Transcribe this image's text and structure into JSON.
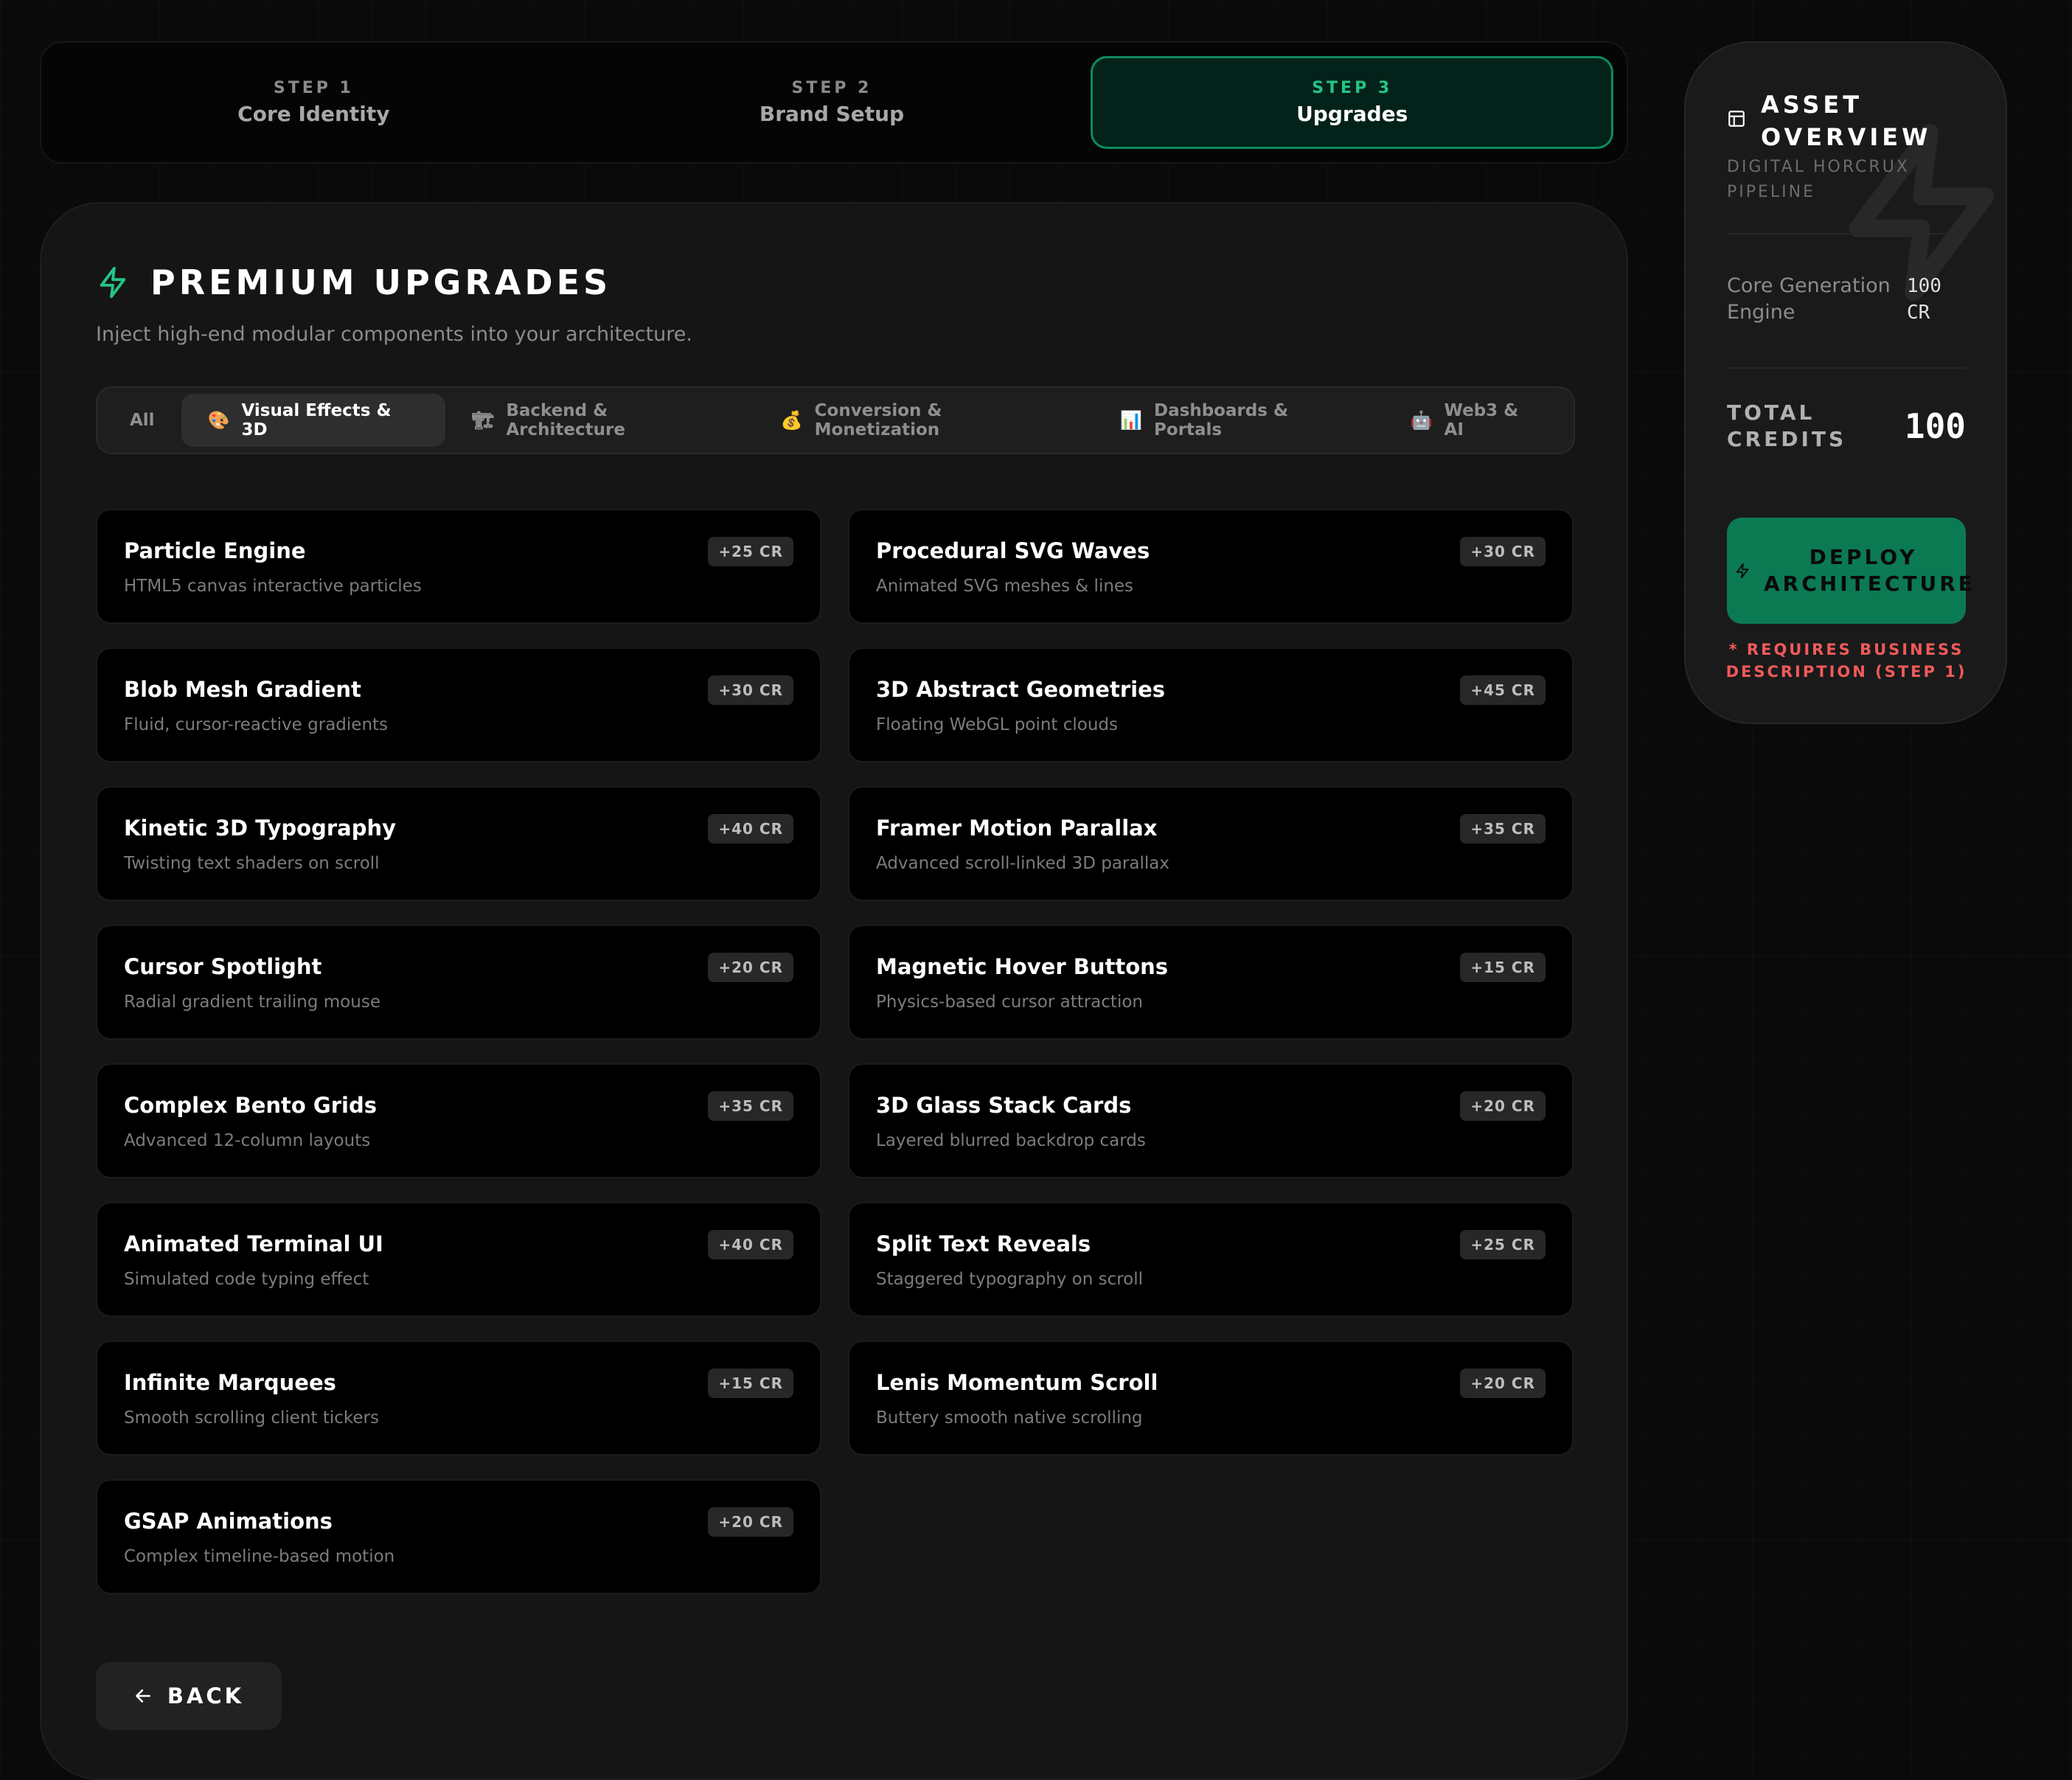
{
  "stepper": {
    "steps": [
      {
        "num": "STEP 1",
        "title": "Core Identity"
      },
      {
        "num": "STEP 2",
        "title": "Brand Setup"
      },
      {
        "num": "STEP 3",
        "title": "Upgrades"
      }
    ],
    "active_step": 3
  },
  "panel": {
    "title": "PREMIUM UPGRADES",
    "subtitle": "Inject high-end modular components into your architecture."
  },
  "tabs": [
    {
      "label": "All",
      "icon": ""
    },
    {
      "label": "Visual Effects & 3D",
      "icon": "🎨"
    },
    {
      "label": "Backend & Architecture",
      "icon": "🏗"
    },
    {
      "label": "Conversion & Monetization",
      "icon": "💰"
    },
    {
      "label": "Dashboards & Portals",
      "icon": "📊"
    },
    {
      "label": "Web3 & AI",
      "icon": "🤖"
    }
  ],
  "active_tab": "Visual Effects & 3D",
  "cards": [
    {
      "title": "Particle Engine",
      "desc": "HTML5 canvas interactive particles",
      "price": "+25 CR"
    },
    {
      "title": "Procedural SVG Waves",
      "desc": "Animated SVG meshes & lines",
      "price": "+30 CR"
    },
    {
      "title": "Blob Mesh Gradient",
      "desc": "Fluid, cursor-reactive gradients",
      "price": "+30 CR"
    },
    {
      "title": "3D Abstract Geometries",
      "desc": "Floating WebGL point clouds",
      "price": "+45 CR"
    },
    {
      "title": "Kinetic 3D Typography",
      "desc": "Twisting text shaders on scroll",
      "price": "+40 CR"
    },
    {
      "title": "Framer Motion Parallax",
      "desc": "Advanced scroll-linked 3D parallax",
      "price": "+35 CR"
    },
    {
      "title": "Cursor Spotlight",
      "desc": "Radial gradient trailing mouse",
      "price": "+20 CR"
    },
    {
      "title": "Magnetic Hover Buttons",
      "desc": "Physics-based cursor attraction",
      "price": "+15 CR"
    },
    {
      "title": "Complex Bento Grids",
      "desc": "Advanced 12-column layouts",
      "price": "+35 CR"
    },
    {
      "title": "3D Glass Stack Cards",
      "desc": "Layered blurred backdrop cards",
      "price": "+20 CR"
    },
    {
      "title": "Animated Terminal UI",
      "desc": "Simulated code typing effect",
      "price": "+40 CR"
    },
    {
      "title": "Split Text Reveals",
      "desc": "Staggered typography on scroll",
      "price": "+25 CR"
    },
    {
      "title": "Infinite Marquees",
      "desc": "Smooth scrolling client tickers",
      "price": "+15 CR"
    },
    {
      "title": "Lenis Momentum Scroll",
      "desc": "Buttery smooth native scrolling",
      "price": "+20 CR"
    },
    {
      "title": "GSAP Animations",
      "desc": "Complex timeline-based motion",
      "price": "+20 CR"
    }
  ],
  "back_label": "BACK",
  "sidebar": {
    "title": "ASSET OVERVIEW",
    "subtitle": "DIGITAL HORCRUX PIPELINE",
    "line_items": [
      {
        "label": "Core Generation Engine",
        "value": "100 CR"
      }
    ],
    "total_label": "TOTAL CREDITS",
    "total_value": "100",
    "deploy_label": "DEPLOY ARCHITECTURE",
    "requires_note": "* REQUIRES BUSINESS DESCRIPTION (STEP 1)"
  },
  "colors": {
    "accent": "#25c486",
    "deploy": "#0b7a53",
    "warning": "#f05a5a",
    "background": "#0a0a0a"
  },
  "icons": {
    "panel_title": "lightning-bolt-icon",
    "sidebar_title": "layout-panel-icon",
    "deploy": "lightning-bolt-icon",
    "back": "arrow-left-icon"
  }
}
